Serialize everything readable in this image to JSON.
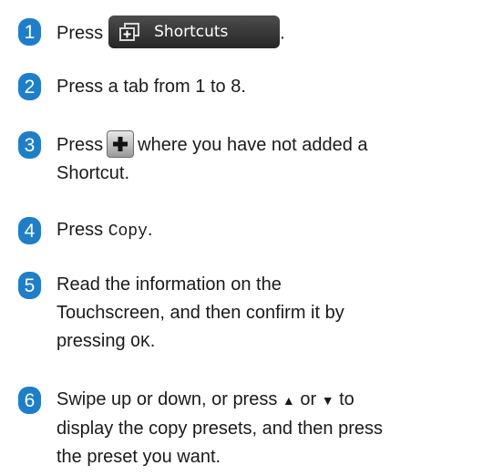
{
  "steps": [
    {
      "num": "1",
      "before": "Press",
      "button_label": "Shortcuts",
      "after": "."
    },
    {
      "num": "2",
      "text": "Press a tab from 1 to 8."
    },
    {
      "num": "3",
      "before": "Press",
      "after_line1": "where you have not added a",
      "line2": "Shortcut."
    },
    {
      "num": "4",
      "before": "Press",
      "mono": "Copy",
      "after": "."
    },
    {
      "num": "5",
      "line1": "Read the information on the",
      "line2": "Touchscreen, and then confirm it by",
      "line3_before": "pressing",
      "line3_mono": "OK",
      "line3_after": "."
    },
    {
      "num": "6",
      "line1_before": "Swipe up or down, or press",
      "up_symbol": "▲",
      "or_word": "or",
      "down_symbol": "▼",
      "line1_after": "to",
      "line2": "display the copy presets, and then press",
      "line3": "the preset you want."
    }
  ],
  "colors": {
    "badge": "#1e7ec8",
    "shortcut_button": "#333333"
  },
  "icons": {
    "shortcuts_button_icon": "add-shortcut-icon",
    "plus_button_icon": "plus-icon"
  }
}
